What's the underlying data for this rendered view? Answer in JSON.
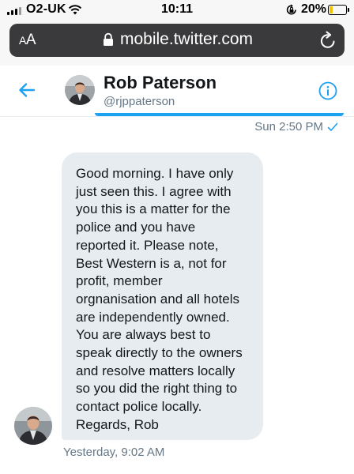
{
  "status_bar": {
    "carrier": "O2-UK",
    "time": "10:11",
    "battery_pct": "20%",
    "battery_level": 0.2
  },
  "browser": {
    "text_size_label_small": "A",
    "text_size_label_large": "A",
    "url": "mobile.twitter.com"
  },
  "conversation": {
    "name": "Rob Paterson",
    "handle": "@rjppaterson"
  },
  "messages": {
    "sent_timestamp": "Sun 2:50 PM",
    "received_text": "Good morning. I have only\njust seen this. I agree with\nyou this is a matter for the\npolice and you have\nreported it. Please note,\nBest Western is a, not for\nprofit, member\norgnanisation and all hotels\nare independently owned.\nYou are always best to\nspeak directly to the owners\nand resolve matters locally\nso you did the right thing to\ncontact police locally.\nRegards, Rob",
    "received_timestamp": "Yesterday, 9:02 AM"
  },
  "colors": {
    "accent": "#1da1f2",
    "bubble_received": "#e6ecf0",
    "meta_text": "#657786"
  },
  "icons": [
    "signal-icon",
    "wifi-icon",
    "orientation-lock-icon",
    "battery-icon",
    "padlock-icon",
    "reload-icon",
    "back-arrow-icon",
    "info-icon",
    "read-check-icon"
  ]
}
